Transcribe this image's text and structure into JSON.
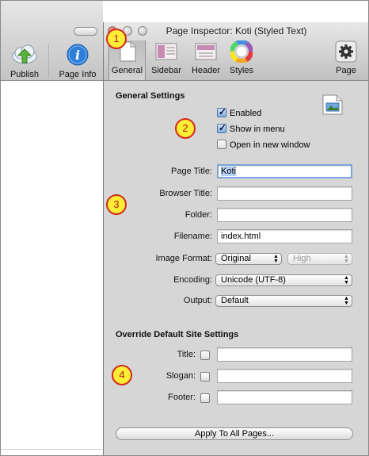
{
  "app": {
    "toolbar": {
      "publish_label": "Publish",
      "page_info_label": "Page Info"
    }
  },
  "inspector": {
    "window_title": "Page Inspector: Koti (Styled Text)",
    "tabs": [
      {
        "label": "General",
        "icon": "page-icon",
        "selected": true
      },
      {
        "label": "Sidebar",
        "icon": "sidebar-layout-icon"
      },
      {
        "label": "Header",
        "icon": "header-layout-icon"
      },
      {
        "label": "Styles",
        "icon": "color-wheel-icon"
      },
      {
        "label": "Page",
        "icon": "gear-icon"
      }
    ],
    "general": {
      "section_title": "General Settings",
      "enabled_label": "Enabled",
      "enabled_checked": true,
      "show_in_menu_label": "Show in menu",
      "show_in_menu_checked": true,
      "open_new_window_label": "Open in new window",
      "open_new_window_checked": false,
      "page_title_label": "Page Title:",
      "page_title_value": "Koti",
      "browser_title_label": "Browser Title:",
      "browser_title_value": "",
      "folder_label": "Folder:",
      "folder_value": "",
      "filename_label": "Filename:",
      "filename_value": "index.html",
      "image_format_label": "Image Format:",
      "image_format_value": "Original",
      "image_quality_value": "High",
      "encoding_label": "Encoding:",
      "encoding_value": "Unicode (UTF-8)",
      "output_label": "Output:",
      "output_value": "Default"
    },
    "override": {
      "section_title": "Override Default Site Settings",
      "title_label": "Title:",
      "slogan_label": "Slogan:",
      "footer_label": "Footer:"
    },
    "apply_button_label": "Apply To All Pages..."
  },
  "callouts": [
    "1",
    "2",
    "3",
    "4"
  ],
  "colors": {
    "callout_fill": "#ffee35",
    "callout_border": "#d42a1c",
    "focus_ring": "#7ba6d9"
  }
}
